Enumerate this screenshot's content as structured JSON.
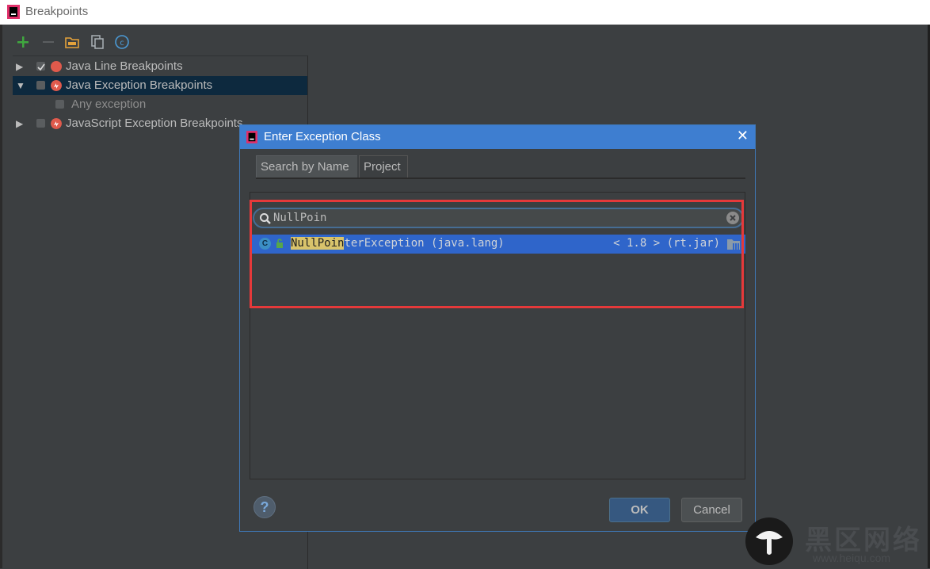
{
  "window": {
    "title": "Breakpoints"
  },
  "toolbar": {
    "add_icon": "plus-icon",
    "remove_icon": "minus-icon",
    "group_icon": "folder-icon",
    "copy_icon": "copy-icon",
    "class_icon": "class-icon"
  },
  "tree": {
    "items": [
      {
        "label": "Java Line Breakpoints",
        "expanded": false,
        "checked": true,
        "icon": "breakpoint-icon"
      },
      {
        "label": "Java Exception Breakpoints",
        "expanded": true,
        "checked": false,
        "icon": "exception-breakpoint-icon",
        "selected": true
      },
      {
        "label": "Any exception",
        "checked": false,
        "child": true
      },
      {
        "label": "JavaScript Exception Breakpoints",
        "expanded": false,
        "checked": false,
        "icon": "exception-breakpoint-icon"
      }
    ]
  },
  "dialog": {
    "title": "Enter Exception Class",
    "close_icon": "close-icon",
    "tabs": [
      {
        "label": "Search by Name",
        "active": true
      },
      {
        "label": "Project",
        "active": false
      }
    ],
    "search": {
      "value": "NullPoin"
    },
    "result": {
      "match": "NullPoin",
      "rest": "terException (java.lang)",
      "right": "< 1.8 > (rt.jar)"
    },
    "help_label": "?",
    "ok_label": "OK",
    "cancel_label": "Cancel"
  },
  "watermark": {
    "text": "黑区网络",
    "url": "www.heiqu.com"
  },
  "colors": {
    "accent": "#3e7ed0",
    "selection": "#2f65ca",
    "highlight": "#e5393a",
    "background": "#3c3f41"
  }
}
